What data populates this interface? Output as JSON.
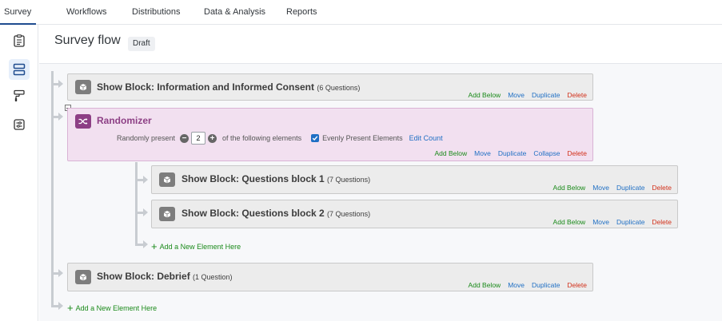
{
  "tabs": [
    {
      "label": "Survey",
      "active": true
    },
    {
      "label": "Workflows"
    },
    {
      "label": "Distributions"
    },
    {
      "label": "Data & Analysis"
    },
    {
      "label": "Reports"
    }
  ],
  "rail": [
    "survey-outline-icon",
    "survey-flow-icon",
    "look-and-feel-icon",
    "survey-options-icon"
  ],
  "header": {
    "title": "Survey flow",
    "badge": "Draft"
  },
  "flow": {
    "block1": {
      "title": "Show Block: Information and Informed Consent",
      "count": "(6 Questions)"
    },
    "randomizer": {
      "title": "Randomizer",
      "present_prefix": "Randomly present",
      "present_value": "2",
      "present_suffix": "of the following elements",
      "evenly_label": "Evenly Present Elements",
      "edit_count": "Edit Count"
    },
    "block2": {
      "title": "Show Block: Questions block 1",
      "count": "(7 Questions)"
    },
    "block3": {
      "title": "Show Block: Questions block 2",
      "count": "(7 Questions)"
    },
    "inner_add": "Add a New Element Here",
    "block4": {
      "title": "Show Block: Debrief",
      "count": "(1 Question)"
    },
    "outer_add": "Add a New Element Here"
  },
  "actions": {
    "add_below": "Add Below",
    "move": "Move",
    "duplicate": "Duplicate",
    "collapse": "Collapse",
    "delete": "Delete"
  },
  "colors": {
    "add": "#1a8a1a",
    "link": "#1f6fc4",
    "delete": "#d2301a",
    "randomizer": "#8d3f85"
  }
}
